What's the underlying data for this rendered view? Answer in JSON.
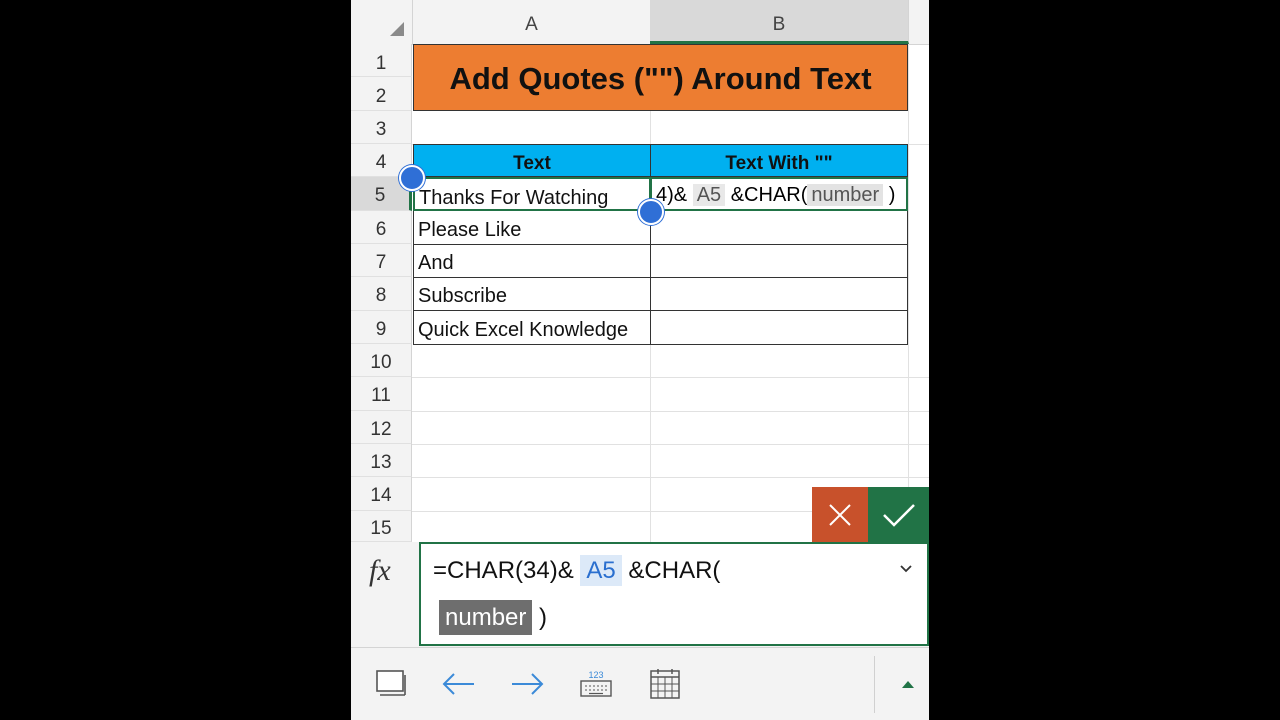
{
  "columns": [
    {
      "label": "A",
      "selected": false
    },
    {
      "label": "B",
      "selected": true
    }
  ],
  "rows": [
    "1",
    "2",
    "3",
    "4",
    "5",
    "6",
    "7",
    "8",
    "9",
    "10",
    "11",
    "12",
    "13",
    "14",
    "15"
  ],
  "selected_row": "5",
  "title": "Add Quotes (\"\") Around Text",
  "table": {
    "header_text": "Text",
    "header_with": "Text With \"\"",
    "items": [
      "Thanks For Watching",
      "Please Like",
      "And",
      "Subscribe",
      "Quick Excel Knowledge"
    ]
  },
  "cell_b5": {
    "prefix": "4)&",
    "ref": "A5",
    "mid": "&CHAR(",
    "arg": "number",
    "suffix": ")"
  },
  "formula": {
    "fx": "fx",
    "part1": "=CHAR(34)&",
    "ref": "A5",
    "part2": "&CHAR(",
    "arg": "number",
    "close": ")"
  },
  "colors": {
    "title_bg": "#ed7d31",
    "header_bg": "#00b0f0",
    "excel_green": "#217346",
    "cancel_red": "#c8512b",
    "handle_blue": "#2f6fd6"
  },
  "toolbar_icons": [
    "sheet-view-icon",
    "arrow-left-icon",
    "arrow-right-icon",
    "keyboard-123-icon",
    "calendar-grid-icon",
    "caret-up-icon"
  ]
}
